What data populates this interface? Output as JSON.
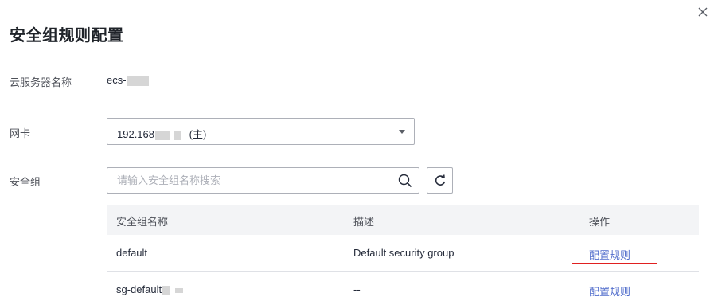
{
  "dialog": {
    "title": "安全组规则配置",
    "close_icon": "close-icon"
  },
  "server": {
    "label": "云服务器名称",
    "name_prefix": "ecs-"
  },
  "nic": {
    "label": "网卡",
    "selected_prefix": "192.168",
    "selected_suffix": "(主)"
  },
  "security_group": {
    "label": "安全组",
    "search_placeholder": "请输入安全组名称搜索",
    "search_icon": "search-icon",
    "refresh_icon": "refresh-icon"
  },
  "table": {
    "headers": [
      "安全组名称",
      "描述",
      "操作"
    ],
    "rows": [
      {
        "name": "default",
        "description": "Default security group",
        "action": "配置规则"
      },
      {
        "name": "sg-default",
        "description": "--",
        "action": "配置规则"
      }
    ]
  },
  "colors": {
    "link": "#526ecc",
    "highlight_border": "#e02020",
    "header_bg": "#f3f4f6"
  }
}
